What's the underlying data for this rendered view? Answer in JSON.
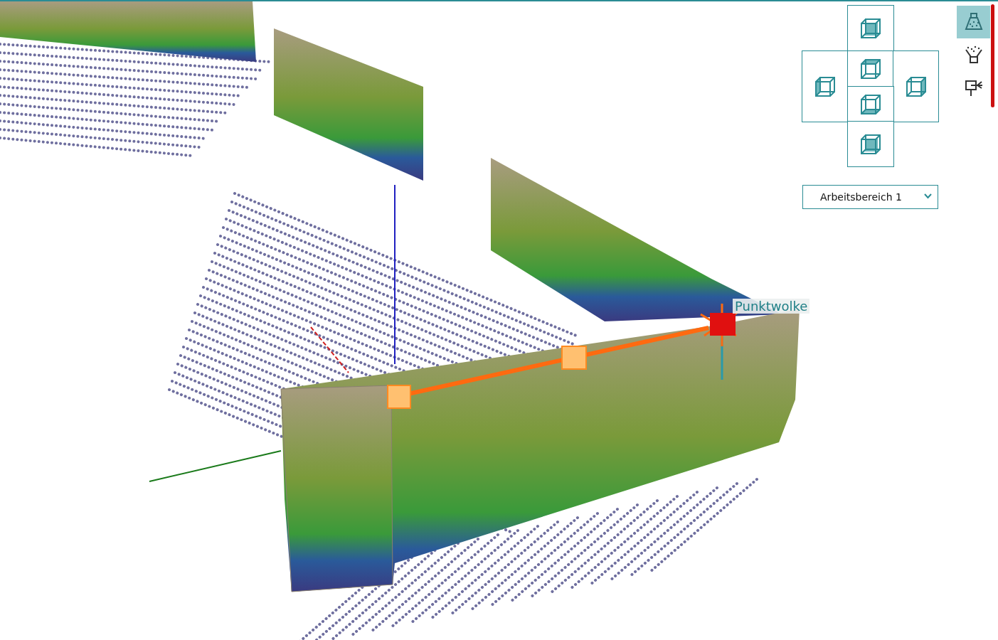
{
  "viewport": {
    "label": "Punktwolke"
  },
  "workspace_select": {
    "value": "Arbeitsbereich 1"
  },
  "tools": [
    {
      "kind": "scan",
      "selected": true
    },
    {
      "kind": "filter",
      "selected": false
    },
    {
      "kind": "tree",
      "selected": false
    }
  ]
}
